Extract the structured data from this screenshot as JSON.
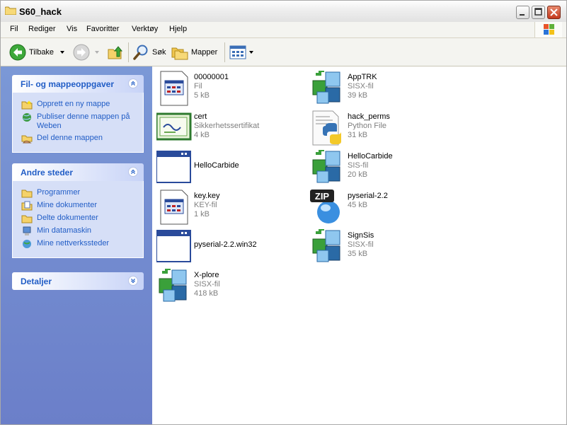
{
  "window": {
    "title": "S60_hack"
  },
  "menu": {
    "items": [
      "Fil",
      "Rediger",
      "Vis",
      "Favoritter",
      "Verktøy",
      "Hjelp"
    ]
  },
  "toolbar": {
    "back_label": "Tilbake",
    "search_label": "Søk",
    "folders_label": "Mapper"
  },
  "tasks_panel": {
    "title": "Fil- og mappeoppgaver",
    "links": [
      "Opprett en ny mappe",
      "Publiser denne mappen på Weben",
      "Del denne mappen"
    ]
  },
  "places_panel": {
    "title": "Andre steder",
    "links": [
      "Programmer",
      "Mine dokumenter",
      "Delte dokumenter",
      "Min datamaskin",
      "Mine nettverkssteder"
    ]
  },
  "details_panel": {
    "title": "Detaljer"
  },
  "files": [
    {
      "name": "00000001",
      "type": "Fil",
      "size": "5 kB",
      "icon": "generic-file-icon"
    },
    {
      "name": "AppTRK",
      "type": "SISX-fil",
      "size": "39 kB",
      "icon": "sis-package-icon"
    },
    {
      "name": "cert",
      "type": "Sikkerhetssertifikat",
      "size": "4 kB",
      "icon": "certificate-icon"
    },
    {
      "name": "hack_perms",
      "type": "Python File",
      "size": "31 kB",
      "icon": "python-file-icon"
    },
    {
      "name": "HelloCarbide",
      "type": "",
      "size": "",
      "icon": "application-window-icon"
    },
    {
      "name": "HelloCarbide",
      "type": "SIS-fil",
      "size": "20 kB",
      "icon": "sis-package-icon"
    },
    {
      "name": "key.key",
      "type": "KEY-fil",
      "size": "1 kB",
      "icon": "generic-file-icon"
    },
    {
      "name": "pyserial-2.2",
      "type": "",
      "size": "45 kB",
      "icon": "zip-archive-icon"
    },
    {
      "name": "pyserial-2.2.win32",
      "type": "",
      "size": "",
      "icon": "application-window-icon"
    },
    {
      "name": "SignSis",
      "type": "SISX-fil",
      "size": "35 kB",
      "icon": "sis-package-icon"
    },
    {
      "name": "X-plore",
      "type": "SISX-fil",
      "size": "418 kB",
      "icon": "sis-package-icon"
    }
  ],
  "colors": {
    "task_link": "#215dc6",
    "left_pane": "#7b98d6",
    "secondary_text": "#7f7f7f"
  }
}
